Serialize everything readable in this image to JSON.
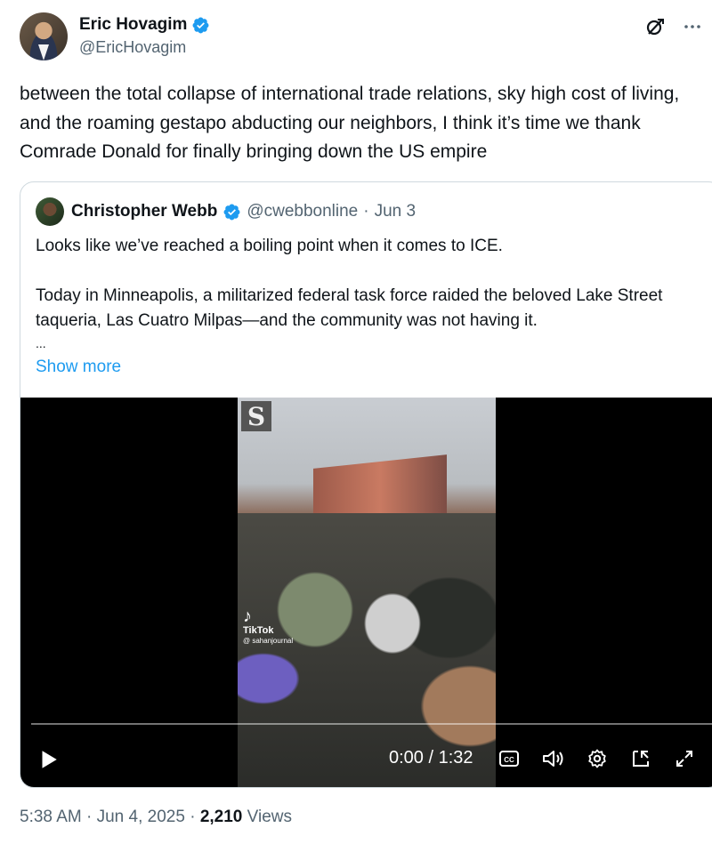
{
  "tweet": {
    "author_name": "Eric Hovagim",
    "author_handle": "@EricHovagim",
    "text": "between the total collapse of international trade relations, sky high cost of living, and the roaming gestapo abducting our neighbors, I think it’s time we thank Comrade Donald for finally bringing down the US empire",
    "time": "5:38 AM",
    "date": "Jun 4, 2025",
    "views_count": "2,210",
    "views_label": "Views",
    "separator": "·"
  },
  "quote": {
    "author_name": "Christopher Webb",
    "author_handle": "@cwebbonline",
    "date": "Jun 3",
    "separator": "·",
    "paragraph1": "Looks like we’ve reached a boiling point when it comes to ICE.",
    "paragraph2": "Today in Minneapolis, a militarized federal task force raided the beloved Lake Street taqueria, Las Cuatro Milpas—and the community was not having it.",
    "ellipsis": "...",
    "show_more": "Show more"
  },
  "video": {
    "time_display": "0:00 / 1:32",
    "progress": 0,
    "tiktok_label": "TikTok",
    "tiktok_handle": "@ sahanjournal"
  },
  "icons": {
    "verified": "verified-badge-icon",
    "grok": "grok-icon",
    "more": "more-options-icon",
    "play": "play-icon",
    "captions": "captions-icon",
    "volume": "volume-icon",
    "settings": "settings-gear-icon",
    "pip": "picture-in-picture-icon",
    "fullscreen": "fullscreen-icon"
  },
  "colors": {
    "verified": "#1d9bf0",
    "link": "#1d9bf0",
    "secondary_text": "#536471",
    "primary_text": "#0f1419"
  }
}
